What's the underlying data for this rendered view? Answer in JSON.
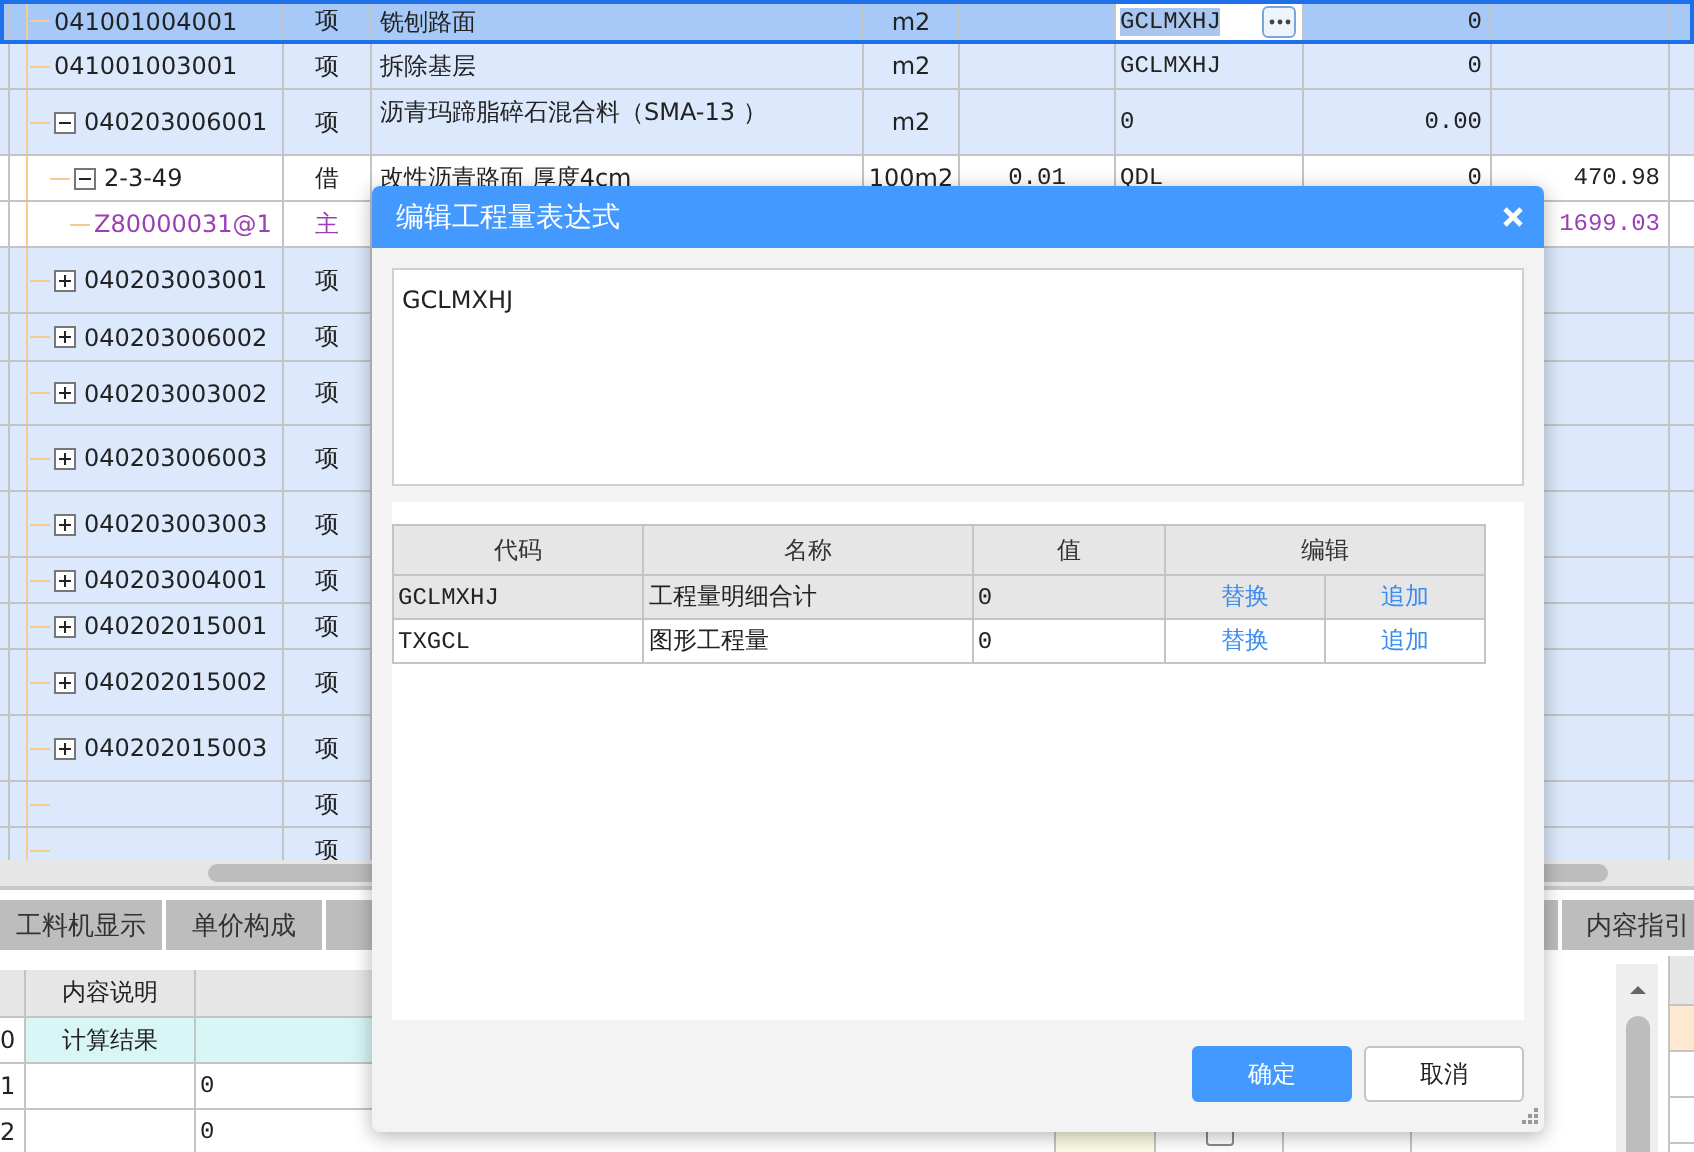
{
  "grid": {
    "rows": [
      {
        "code": "041001004001",
        "type": "项",
        "name": "铣刨路面",
        "unit": "m2",
        "expression": "GCLMXHJ",
        "value": "0",
        "kind": "item",
        "selected": true
      },
      {
        "code": "041001003001",
        "type": "项",
        "name": "拆除基层",
        "unit": "m2",
        "expression": "GCLMXHJ",
        "value": "0",
        "kind": "item",
        "selected": false
      },
      {
        "code": "040203006001",
        "type": "项",
        "name": "沥青玛蹄脂碎石混合料（SMA-13 ）",
        "unit": "m2",
        "expression": "0",
        "value": "0.00",
        "kind": "item",
        "selected": false,
        "expanded": true,
        "children": [
          {
            "code": "2-3-49",
            "type": "借",
            "name": "改性沥青路面 厚度4cm",
            "unit": "100m2",
            "quantity": "0.01",
            "expression": "QDL",
            "value": "0",
            "amount": "470.98",
            "kind": "quota",
            "selected": false,
            "expanded": true,
            "children": [
              {
                "code": "Z80000031@1",
                "type": "主",
                "amount": "1699.03",
                "kind": "material",
                "selected": false
              }
            ]
          }
        ]
      },
      {
        "code": "040203003001",
        "type": "项",
        "kind": "item",
        "selected": false,
        "expanded": false
      },
      {
        "code": "040203006002",
        "type": "项",
        "kind": "item",
        "selected": false,
        "expanded": false
      },
      {
        "code": "040203003002",
        "type": "项",
        "kind": "item",
        "selected": false,
        "expanded": false
      },
      {
        "code": "040203006003",
        "type": "项",
        "kind": "item",
        "selected": false,
        "expanded": false
      },
      {
        "code": "040203003003",
        "type": "项",
        "kind": "item",
        "selected": false,
        "expanded": false
      },
      {
        "code": "040203004001",
        "type": "项",
        "kind": "item",
        "selected": false,
        "expanded": false
      },
      {
        "code": "040202015001",
        "type": "项",
        "kind": "item",
        "selected": false,
        "expanded": false
      },
      {
        "code": "040202015002",
        "type": "项",
        "kind": "item",
        "selected": false,
        "expanded": false
      },
      {
        "code": "040202015003",
        "type": "项",
        "kind": "item",
        "selected": false,
        "expanded": false
      },
      {
        "type": "项",
        "kind": "item",
        "selected": false
      },
      {
        "type": "项",
        "kind": "item",
        "selected": false
      }
    ]
  },
  "tabs": [
    {
      "kind": "labeled",
      "label": "工料机显示"
    },
    {
      "kind": "labeled",
      "label": "单价构成"
    },
    {
      "kind": "covered"
    },
    {
      "kind": "covered"
    },
    {
      "kind": "labeled",
      "label": "内容指引"
    }
  ],
  "detail_grid": {
    "columns": [
      "内容说明"
    ],
    "rows": [
      {
        "number": "0",
        "description": "计算结果",
        "selected": true
      },
      {
        "number": "1",
        "value": "0",
        "selected": false
      },
      {
        "number": "2",
        "value": "0",
        "selected": false,
        "checked": false
      }
    ]
  },
  "dialog": {
    "title": "编辑工程量表达式",
    "expression": "GCLMXHJ",
    "table": {
      "columns": [
        "代码",
        "名称",
        "值",
        "编辑"
      ],
      "rows": [
        {
          "code": "GCLMXHJ",
          "name": "工程量明细合计",
          "value": "0",
          "actions": [
            "替换",
            "追加"
          ],
          "selected": true
        },
        {
          "code": "TXGCL",
          "name": "图形工程量",
          "value": "0",
          "actions": [
            "替换",
            "追加"
          ],
          "selected": false
        }
      ]
    },
    "buttons": [
      {
        "label": "确定",
        "kind": "primary"
      },
      {
        "label": "取消",
        "kind": "secondary"
      }
    ]
  }
}
